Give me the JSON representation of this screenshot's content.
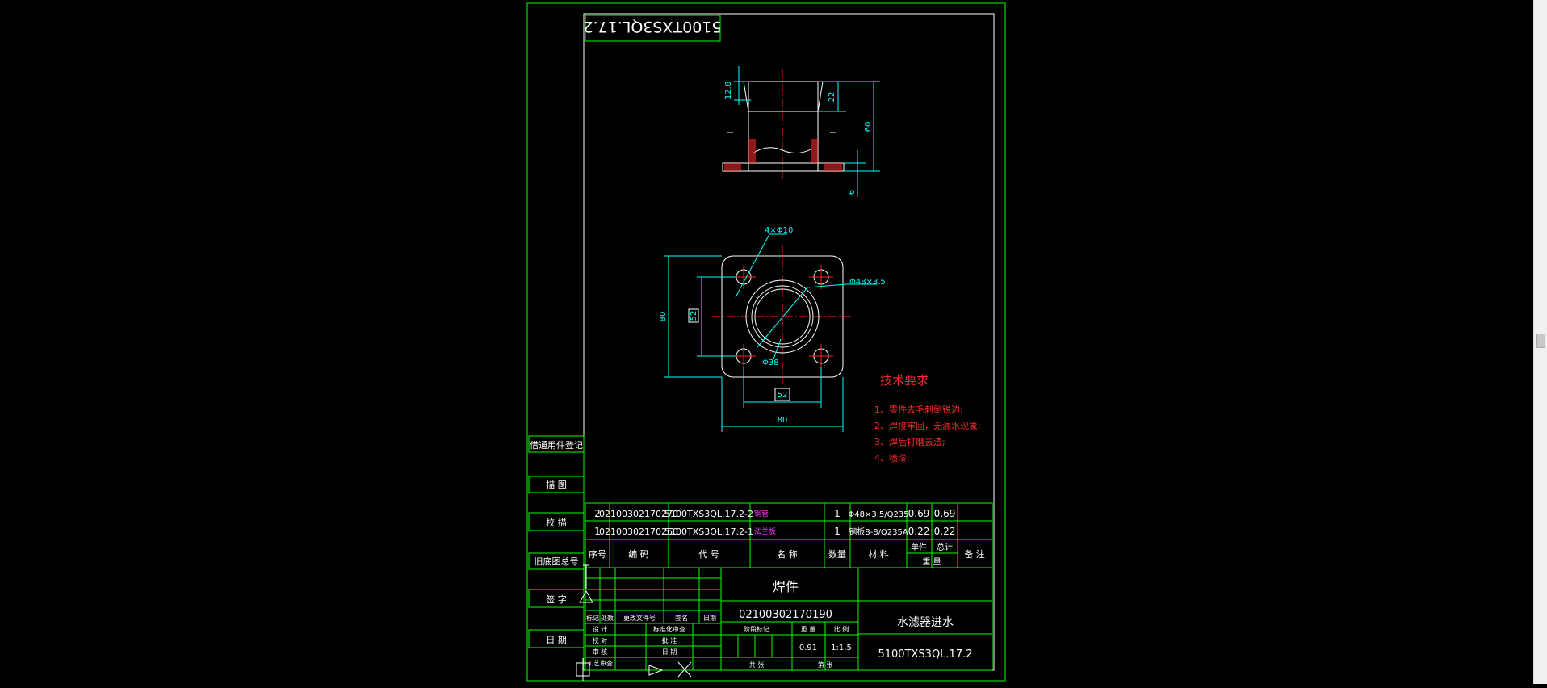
{
  "drawing": {
    "rotated_code": "5100TXS3QL.17.2",
    "tech_title": "技术要求",
    "tech_lines": [
      "1、零件去毛刺倒锐边;",
      "2、焊接牢固，无漏水现象;",
      "3、焊后打磨去渣;",
      "4、喷漆;"
    ],
    "dims": {
      "d12_6": "12.6",
      "d22": "22",
      "d60": "60",
      "d6": "6",
      "holes": "4×Φ10",
      "tube": "Φ48×3.5",
      "d80v": "80",
      "d52v": "52",
      "d38": "Φ38",
      "d52h": "52",
      "d80h": "80"
    },
    "side_labels": [
      "借通用件登记",
      "描 图",
      "校 描",
      "旧底图总号",
      "签 字",
      "日 期"
    ],
    "bom": {
      "rows": [
        {
          "seq": "2",
          "code": "02100302170270",
          "part": "5100TXS3QL.17.2-2",
          "name": "钢管",
          "qty": "1",
          "material": "Φ48×3.5/Q235",
          "unit_w": "0.69",
          "total_w": "0.69",
          "note": ""
        },
        {
          "seq": "1",
          "code": "02100302170260",
          "part": "5100TXS3QL.17.2-1",
          "name": "法兰板",
          "qty": "1",
          "material": "钢板8-8/Q235A",
          "unit_w": "0.22",
          "total_w": "0.22",
          "note": ""
        }
      ],
      "headers": {
        "seq": "序号",
        "code": "编 码",
        "part": "代 号",
        "name": "名 称",
        "qty": "数量",
        "material": "材 料",
        "unit": "单件",
        "total": "总计",
        "weight": "重 量",
        "note": "备 注"
      }
    },
    "title_block": {
      "part_name": "焊件",
      "part_code": "02100302170190",
      "product_name": "水滤器进水",
      "drawing_no": "5100TXS3QL.17.2",
      "stage_label": "阶段标记",
      "weight_label": "重 量",
      "scale_label": "比 例",
      "weight": "0.91",
      "scale": "1:1.5",
      "sheet_total": "共 张",
      "sheet_no": "第 张",
      "rev_labels": [
        "标记",
        "处数",
        "更改文件号",
        "签名",
        "日期"
      ],
      "role_labels": [
        "设 计",
        "校 对",
        "审 核",
        "工艺审查"
      ],
      "std_label": "标准化审查",
      "approve_labels": [
        "批 准",
        "日 期"
      ]
    }
  }
}
